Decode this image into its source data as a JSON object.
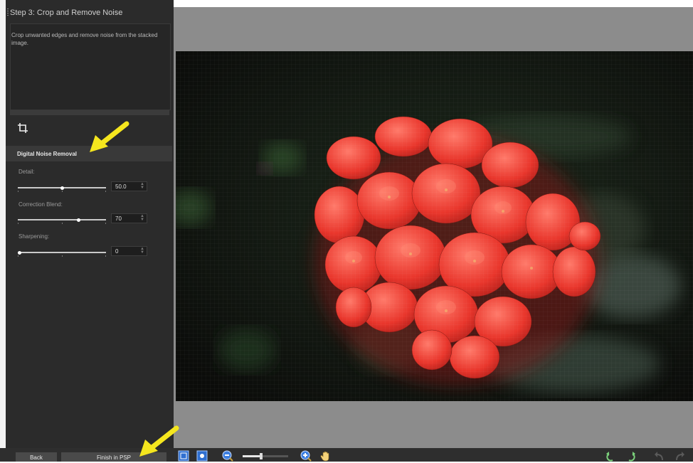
{
  "step": {
    "title": "Step 3: Crop and Remove Noise"
  },
  "description": {
    "text": "Crop unwanted edges and remove noise from the stacked image."
  },
  "noise": {
    "section_title": "Digital Noise Removal",
    "controls": [
      {
        "label": "Detail:",
        "value": "50.0",
        "level": 0.5
      },
      {
        "label": "Correction Blend:",
        "value": "70",
        "level": 0.7
      },
      {
        "label": "Sharpening:",
        "value": "0",
        "level": 0.0
      }
    ]
  },
  "buttons": {
    "back": "Back",
    "finish": "Finish in PSP"
  },
  "toolbar": {
    "icons": [
      "fit-to-window-icon",
      "actual-size-icon",
      "zoom-out-icon",
      "zoom-slider",
      "zoom-in-icon",
      "pan-hand-icon",
      "rotate-left-icon",
      "rotate-right-icon",
      "undo-icon",
      "redo-icon"
    ],
    "zoom_level": 0.4
  },
  "colors": {
    "accent": "#f5e61e",
    "panel": "#2b2b2b",
    "canvas": "#8c8c8c"
  }
}
